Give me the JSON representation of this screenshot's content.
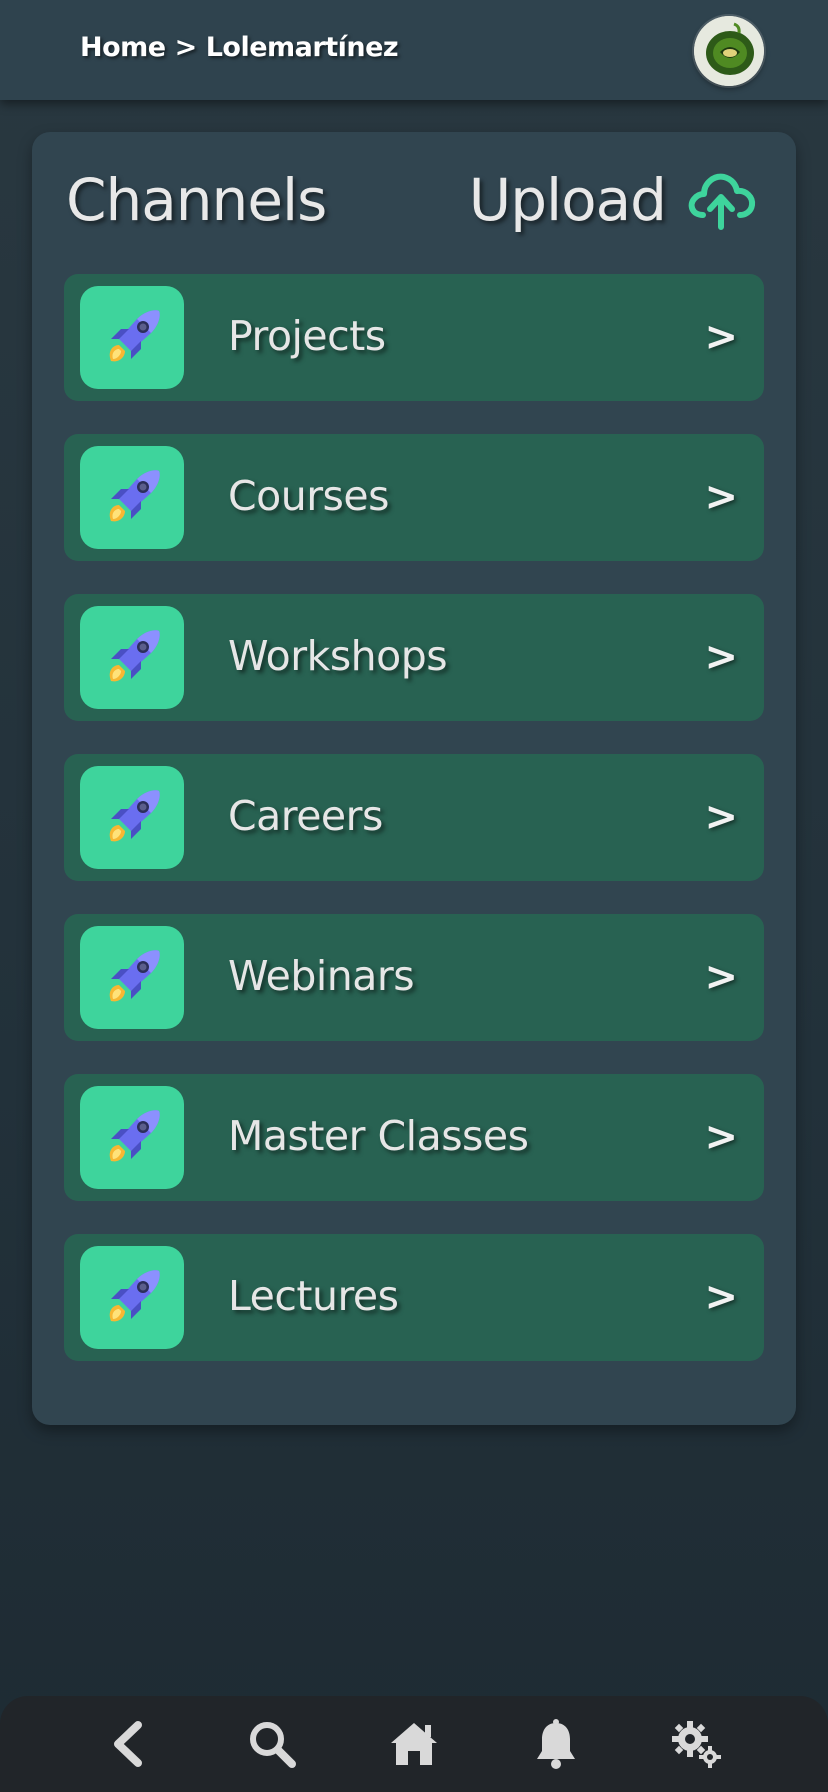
{
  "header": {
    "breadcrumb": {
      "home": "Home",
      "separator": ">",
      "current": "Lolemartínez"
    },
    "avatar_icon": "profile-avatar"
  },
  "panel": {
    "title": "Channels",
    "upload_label": "Upload",
    "upload_icon": "cloud-upload-icon",
    "accent_color": "#3ed49c"
  },
  "channels": [
    {
      "label": "Projects",
      "icon": "rocket-icon",
      "chevron": ">"
    },
    {
      "label": "Courses",
      "icon": "rocket-icon",
      "chevron": ">"
    },
    {
      "label": "Workshops",
      "icon": "rocket-icon",
      "chevron": ">"
    },
    {
      "label": "Careers",
      "icon": "rocket-icon",
      "chevron": ">"
    },
    {
      "label": "Webinars",
      "icon": "rocket-icon",
      "chevron": ">"
    },
    {
      "label": "Master Classes",
      "icon": "rocket-icon",
      "chevron": ">"
    },
    {
      "label": "Lectures",
      "icon": "rocket-icon",
      "chevron": ">"
    }
  ],
  "bottom_nav": [
    {
      "icon": "back-chevron-icon"
    },
    {
      "icon": "search-icon"
    },
    {
      "icon": "home-icon"
    },
    {
      "icon": "bell-icon"
    },
    {
      "icon": "settings-gears-icon"
    }
  ]
}
